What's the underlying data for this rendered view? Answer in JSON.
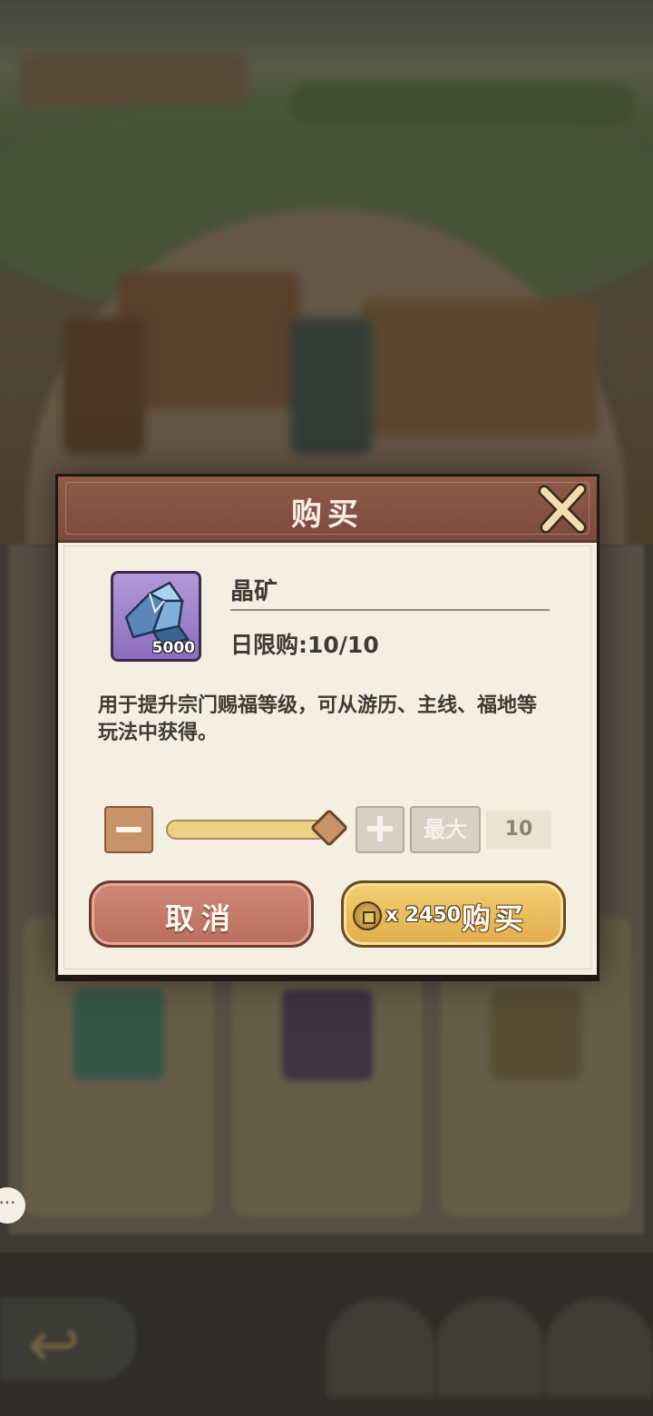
{
  "dialog": {
    "title": "购买",
    "close_icon": "close-x-icon"
  },
  "item": {
    "icon": "crystal-ore-icon",
    "count": "5000",
    "name": "晶矿",
    "limit": "日限购:10/10",
    "description": "用于提升宗门赐福等级，可从游历、主线、福地等玩法中获得。"
  },
  "quantity": {
    "minus_icon": "minus-icon",
    "plus_icon": "plus-icon",
    "max_label": "最大",
    "value": "10",
    "slider_fraction": 1.0
  },
  "actions": {
    "cancel_label": "取消",
    "coin_icon": "copper-coin-icon",
    "price": "x 2450",
    "buy_label": "购买"
  },
  "colors": {
    "header": "#8f5b4a",
    "panel": "#f4efe1",
    "cancel": "#c97d6c",
    "buy": "#eabf60",
    "item_rarity": "#9b7fcb"
  }
}
